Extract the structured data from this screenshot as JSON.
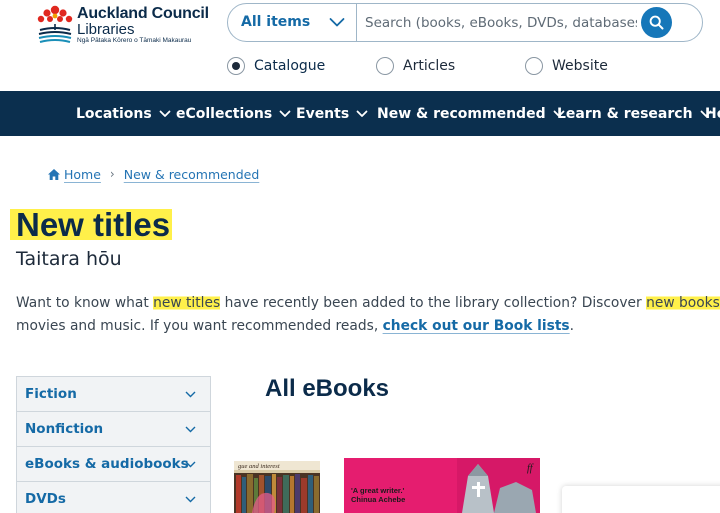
{
  "header": {
    "logo": {
      "title": "Auckland Council",
      "subtitle": "Libraries",
      "tagline": "Ngā Pātaka Kōrero o Tāmaki Makaurau"
    },
    "search": {
      "scope_selected": "All items",
      "placeholder": "Search (books, eBooks, DVDs, databases…)"
    },
    "scopes": [
      {
        "label": "Catalogue",
        "checked": true
      },
      {
        "label": "Articles",
        "checked": false
      },
      {
        "label": "Website",
        "checked": false
      }
    ]
  },
  "nav": {
    "items": [
      {
        "label": "Locations"
      },
      {
        "label": "eCollections"
      },
      {
        "label": "Events"
      },
      {
        "label": "New & recommended"
      },
      {
        "label": "Learn & research"
      },
      {
        "label": "He"
      }
    ]
  },
  "breadcrumb": [
    {
      "label": "Home"
    },
    {
      "label": "New & recommended"
    }
  ],
  "page": {
    "title": "New titles",
    "subtitle": "Taitara hōu",
    "intro": {
      "line1_a": "Want to know what ",
      "line1_hl1": "new titles",
      "line1_b": " have recently been added to the library collection? Discover ",
      "line1_hl2": "new books",
      "line1_c": ",",
      "line2_a": "movies and music. If you want recommended reads, ",
      "line2_link": "check out our Book lists",
      "line2_b": "."
    }
  },
  "sidebar": {
    "items": [
      {
        "label": "Fiction"
      },
      {
        "label": "Nonfiction"
      },
      {
        "label": "eBooks & audiobooks"
      },
      {
        "label": "DVDs"
      }
    ]
  },
  "main": {
    "section_title": "All eBooks",
    "covers": [
      {
        "text": "gue and interest"
      },
      {
        "quote": "'A great writer.'",
        "author": "Chinua Achebe",
        "mark": "ff"
      }
    ]
  },
  "colors": {
    "nav_bg": "#0b2f4e",
    "accent": "#156aa6",
    "highlight": "#fff04a",
    "search_button": "#1677b9"
  }
}
